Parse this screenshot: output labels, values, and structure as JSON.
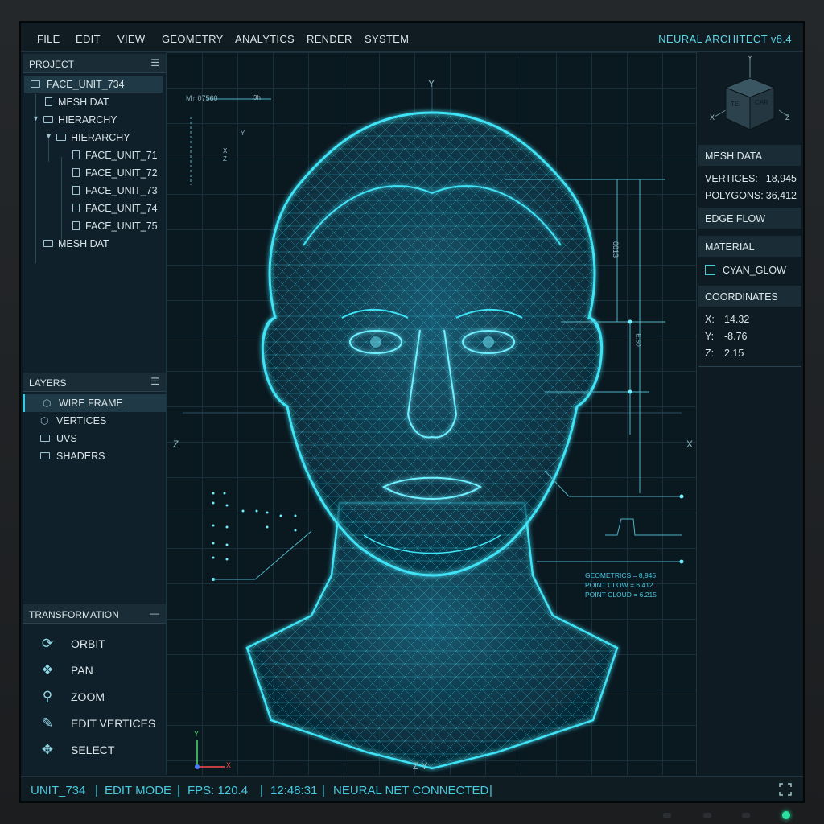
{
  "window": {
    "app_title": "NEURAL ARCHITECT  v8.4"
  },
  "menu": {
    "items": [
      "FILE",
      "EDIT",
      "VIEW",
      "GEOMETRY",
      "ANALYTICS",
      "RENDER",
      "SYSTEM"
    ]
  },
  "project_panel": {
    "title": "PROJECT",
    "menu_icon": "hamburger-icon",
    "tree": [
      {
        "label": "FACE_UNIT_734",
        "type": "folder",
        "selected": true
      },
      {
        "label": "MESH DAT",
        "type": "file"
      },
      {
        "label": "HIERARCHY",
        "type": "folder",
        "expanded": true
      },
      {
        "label": "HIERARCHY",
        "type": "folder",
        "expanded": true
      },
      {
        "label": "FACE_UNIT_71",
        "type": "file"
      },
      {
        "label": "FACE_UNIT_72",
        "type": "file"
      },
      {
        "label": "FACE_UNIT_73",
        "type": "file"
      },
      {
        "label": "FACE_UNIT_74",
        "type": "file"
      },
      {
        "label": "FACE_UNIT_75",
        "type": "file"
      },
      {
        "label": "MESH DAT",
        "type": "folder"
      }
    ]
  },
  "layers_panel": {
    "title": "LAYERS",
    "items": [
      {
        "label": "WIRE FRAME",
        "icon": "cube-icon",
        "selected": true
      },
      {
        "label": "VERTICES",
        "icon": "vertices-icon"
      },
      {
        "label": "UVS",
        "icon": "folder-icon"
      },
      {
        "label": "SHADERS",
        "icon": "folder-icon"
      }
    ]
  },
  "transformation_panel": {
    "title": "TRANSFORMATION",
    "collapse_symbol": "—",
    "tools": [
      {
        "label": "ORBIT",
        "icon": "orbit-icon"
      },
      {
        "label": "PAN",
        "icon": "pan-icon"
      },
      {
        "label": "ZOOM",
        "icon": "zoom-icon"
      },
      {
        "label": "EDIT VERTICES",
        "icon": "pencil-icon"
      },
      {
        "label": "SELECT",
        "icon": "move-arrows-icon"
      }
    ]
  },
  "viewport": {
    "axis_top": "Y",
    "axis_left": "Z",
    "axis_right": "X",
    "axis_bottom": "Z  Y",
    "gizmo_y": "Y",
    "gizmo_x": "X",
    "corner_label": "M↑ 07560",
    "corner_small": "3h",
    "mini_axes": [
      "Y",
      "X",
      "Z"
    ],
    "dim_label_1": "0013",
    "dim_label_2": "E.50",
    "stats": [
      {
        "label": "GEOMETRICS",
        "value": "= 8,945"
      },
      {
        "label": "POINT CLOW",
        "value": "= 6,412"
      },
      {
        "label": "POINT CLOUD",
        "value": "= 6.215"
      }
    ],
    "wire_color": "#3fe3f5"
  },
  "right_panel": {
    "cube_axes": {
      "y": "Y",
      "x": "X",
      "z": "Z"
    },
    "cube_faces": [
      "TEI",
      "CAR"
    ],
    "mesh_data": {
      "title": "MESH DATA",
      "vertices_label": "VERTICES:",
      "vertices_value": "18,945",
      "polygons_label": "POLYGONS:",
      "polygons_value": "36,412"
    },
    "edge_flow_title": "EDGE FLOW",
    "material": {
      "title": "MATERIAL",
      "name": "CYAN_GLOW",
      "checked": false
    },
    "coordinates": {
      "title": "COORDINATES",
      "x_label": "X:",
      "x_value": "14.32",
      "y_label": "Y:",
      "y_value": "-8.76",
      "z_label": "Z:",
      "z_value": "2.15"
    }
  },
  "status_bar": {
    "unit": "UNIT_734",
    "mode": "EDIT MODE",
    "fps": "FPS: 120.4",
    "time": "12:48:31",
    "network": "NEURAL NET CONNECTED",
    "separator": "|",
    "fullscreen_icon": "fullscreen-icon"
  },
  "colors": {
    "accent": "#48c8de",
    "wireframe": "#3fe3f5",
    "panel": "#10202a",
    "background": "#0a1820"
  }
}
